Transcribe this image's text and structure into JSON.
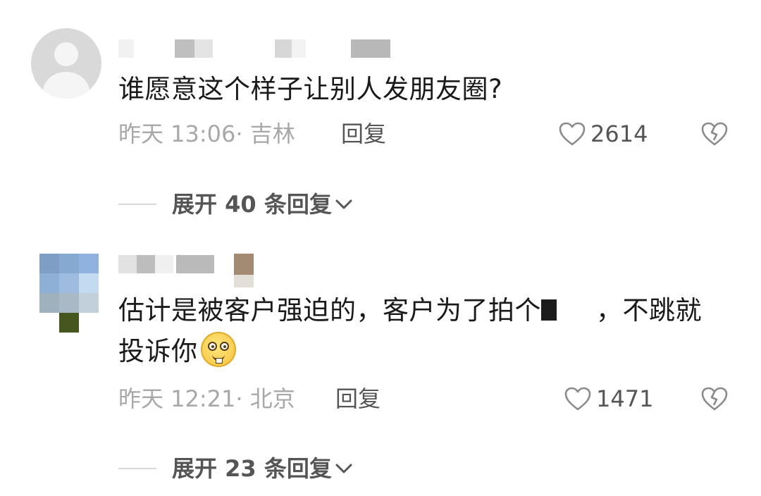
{
  "comments": [
    {
      "text": "谁愿意这个样子让别人发朋友圈?",
      "time": "昨天 13:06",
      "location": "· 吉林",
      "reply_label": "回复",
      "likes": "2614",
      "expand_label": "展开 40 条回复"
    },
    {
      "text_part1": "估计是被客户强迫的，客户为了拍个",
      "text_part2": "，不跳就投诉你",
      "time": "昨天 12:21",
      "location": "· 北京",
      "reply_label": "回复",
      "likes": "1471",
      "expand_label": "展开 23 条回复"
    }
  ],
  "icons": {
    "avatar_default": "person-silhouette-icon",
    "like": "heart-outline-icon",
    "dislike": "broken-heart-icon",
    "expand": "chevron-down-icon",
    "emoji": "grinning-face-emoji-icon"
  },
  "colors": {
    "text_primary": "#1a1a1a",
    "text_meta": "#a8a8a8",
    "text_action": "#555555",
    "avatar_bg": "#d9d9d9"
  }
}
